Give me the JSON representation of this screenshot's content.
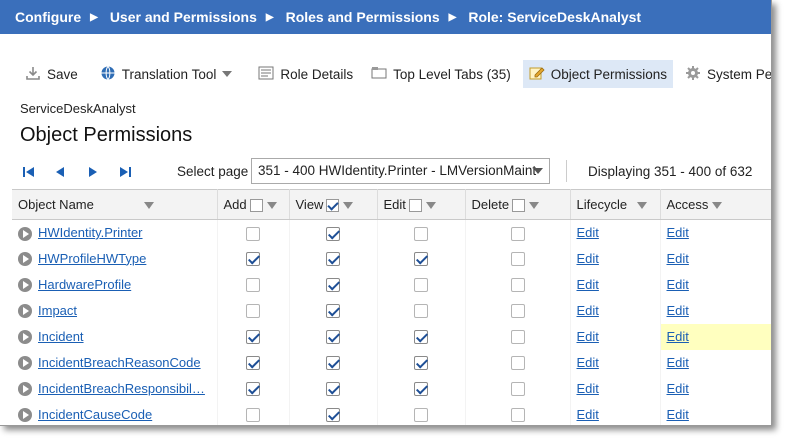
{
  "breadcrumb": [
    "Configure",
    "User and Permissions",
    "Roles and Permissions",
    "Role: ServiceDeskAnalyst"
  ],
  "toolbar": {
    "save": "Save",
    "translation": "Translation Tool",
    "role_details": "Role Details",
    "top_tabs": "Top Level Tabs (35)",
    "object_permissions": "Object Permissions",
    "system_permissions": "System Permissi"
  },
  "role_name": "ServiceDeskAnalyst",
  "page_title": "Object Permissions",
  "pager": {
    "select_label": "Select page",
    "selected": "351 - 400 HWIdentity.Printer - LMVersionMaint",
    "display": "Displaying 351 - 400 of 632"
  },
  "columns": {
    "object_name": "Object Name",
    "add": "Add",
    "view": "View",
    "edit": "Edit",
    "delete": "Delete",
    "lifecycle": "Lifecycle",
    "access": "Access"
  },
  "header_checks": {
    "add": false,
    "view": true,
    "edit": false,
    "delete": false
  },
  "rows": [
    {
      "name": "HWIdentity.Printer",
      "add": false,
      "view": true,
      "edit": false,
      "delete": false,
      "lifecycle": "Edit",
      "access": "Edit"
    },
    {
      "name": "HWProfileHWType",
      "add": true,
      "view": true,
      "edit": true,
      "delete": false,
      "lifecycle": "Edit",
      "access": "Edit"
    },
    {
      "name": "HardwareProfile",
      "add": false,
      "view": true,
      "edit": false,
      "delete": false,
      "lifecycle": "Edit",
      "access": "Edit"
    },
    {
      "name": "Impact",
      "add": false,
      "view": true,
      "edit": false,
      "delete": false,
      "lifecycle": "Edit",
      "access": "Edit"
    },
    {
      "name": "Incident",
      "add": true,
      "view": true,
      "edit": true,
      "delete": false,
      "lifecycle": "Edit",
      "access": "Edit",
      "highlight": true
    },
    {
      "name": "IncidentBreachReasonCode",
      "add": true,
      "view": true,
      "edit": true,
      "delete": false,
      "lifecycle": "Edit",
      "access": "Edit"
    },
    {
      "name": "IncidentBreachResponsibil…",
      "add": true,
      "view": true,
      "edit": true,
      "delete": false,
      "lifecycle": "Edit",
      "access": "Edit"
    },
    {
      "name": "IncidentCauseCode",
      "add": false,
      "view": true,
      "edit": false,
      "delete": false,
      "lifecycle": "Edit",
      "access": "Edit"
    }
  ],
  "colors": {
    "breadcrumb_bg": "#3a6fbb",
    "link": "#1a5fb4",
    "highlight": "#ffffbf",
    "active_tab": "#dde8f6"
  },
  "icons": {
    "save": "download-icon",
    "translation": "globe-icon",
    "role_details": "list-icon",
    "top_tabs": "tabs-icon",
    "object_permissions": "edit-icon",
    "system_permissions": "gear-icon"
  }
}
